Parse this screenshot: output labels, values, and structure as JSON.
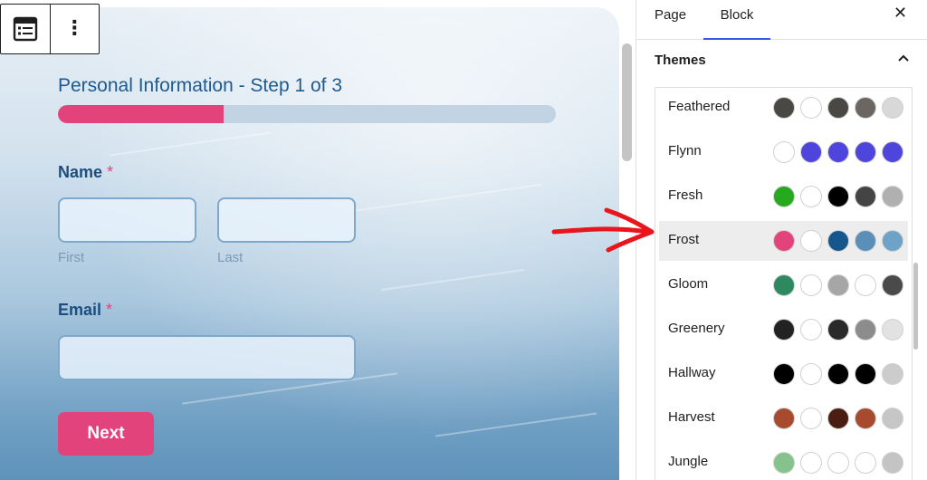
{
  "form": {
    "step_title": "Personal Information - Step 1 of 3",
    "progress_fraction": 0.333,
    "name_label": "Name",
    "required_mark": "*",
    "first_sublabel": "First",
    "last_sublabel": "Last",
    "email_label": "Email",
    "next_button": "Next"
  },
  "toolbar": {
    "more_label": "⋮"
  },
  "sidebar": {
    "tabs": [
      {
        "label": "Page"
      },
      {
        "label": "Block"
      }
    ],
    "active_tab": "Block",
    "close_label": "✕",
    "themes_title": "Themes",
    "themes": [
      {
        "name": "Feathered",
        "colors": [
          "#4a4845",
          "#ffffff",
          "#4a4845",
          "#6b6661",
          "#d8d8d8"
        ]
      },
      {
        "name": "Flynn",
        "colors": [
          "#ffffff",
          "#4e46dc",
          "#4e46dc",
          "#4e46dc",
          "#4e46dc"
        ]
      },
      {
        "name": "Fresh",
        "colors": [
          "#26a81f",
          "#ffffff",
          "#000000",
          "#444444",
          "#b0b0b0"
        ]
      },
      {
        "name": "Frost",
        "colors": [
          "#e2437b",
          "#ffffff",
          "#15578c",
          "#5b8fb8",
          "#6fa2c8"
        ]
      },
      {
        "name": "Gloom",
        "colors": [
          "#2e8a5e",
          "#ffffff",
          "#a6a6a6",
          "#ffffff",
          "#4a4a4a"
        ]
      },
      {
        "name": "Greenery",
        "colors": [
          "#222222",
          "#ffffff",
          "#2a2a2a",
          "#8c8c8c",
          "#e2e2e2"
        ]
      },
      {
        "name": "Hallway",
        "colors": [
          "#000000",
          "#ffffff",
          "#000000",
          "#000000",
          "#cccccc"
        ]
      },
      {
        "name": "Harvest",
        "colors": [
          "#a84a2e",
          "#ffffff",
          "#4a1e12",
          "#a84a2e",
          "#c6c6c6"
        ]
      },
      {
        "name": "Jungle",
        "colors": [
          "#86c38c",
          "#ffffff",
          "#ffffff",
          "#ffffff",
          "#c4c4c4"
        ]
      }
    ],
    "selected_theme": "Frost"
  },
  "colors": {
    "accent": "#e2437b",
    "title_blue": "#1f5a8e",
    "tab_underline": "#3858e9",
    "arrow_red": "#e8161c"
  }
}
